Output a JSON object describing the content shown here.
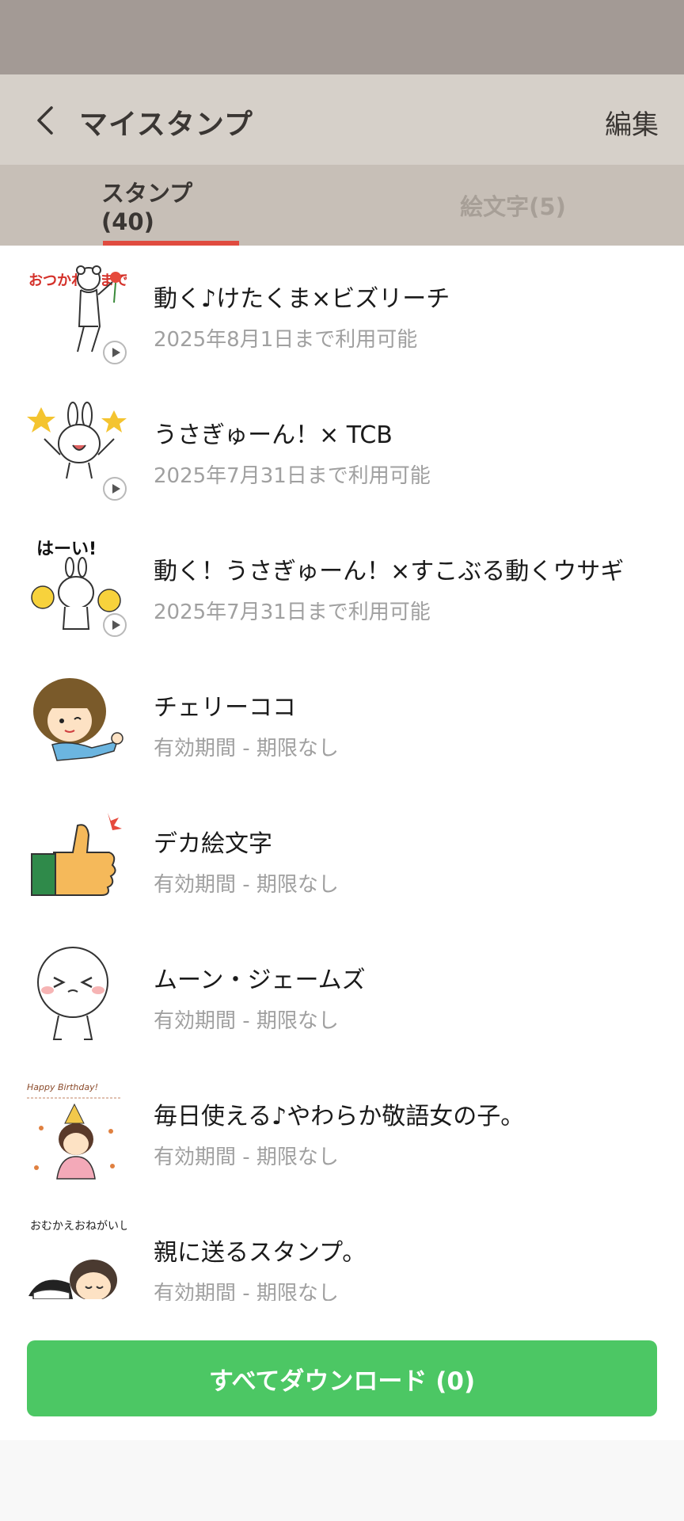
{
  "header": {
    "title": "マイスタンプ",
    "edit_label": "編集"
  },
  "tabs": [
    {
      "label": "スタンプ(40)",
      "active": true
    },
    {
      "label": "絵文字(5)",
      "active": false
    }
  ],
  "items": [
    {
      "name": "動く♪けたくま×ビズリーチ",
      "sub": "2025年8月1日まで利用可能",
      "animated": true,
      "thumb_text": "おつかれさまです"
    },
    {
      "name": "うさぎゅーん！× TCB",
      "sub": "2025年7月31日まで利用可能",
      "animated": true
    },
    {
      "name": "動く！うさぎゅーん！×すこぶる動くウサギ",
      "sub": "2025年7月31日まで利用可能",
      "animated": true,
      "thumb_text": "はーい!"
    },
    {
      "name": "チェリーココ",
      "sub": "有効期間 - 期限なし",
      "animated": false
    },
    {
      "name": "デカ絵文字",
      "sub": "有効期間 - 期限なし",
      "animated": false
    },
    {
      "name": "ムーン・ジェームズ",
      "sub": "有効期間 - 期限なし",
      "animated": false
    },
    {
      "name": "毎日使える♪やわらか敬語女の子。",
      "sub": "有効期間 - 期限なし",
      "animated": false,
      "thumb_text": "Happy Birthday!"
    },
    {
      "name": "親に送るスタンプ。",
      "sub": "有効期間 - 期限なし",
      "animated": false,
      "thumb_text": "おむかえおねがいします"
    }
  ],
  "footer": {
    "download_label": "すべてダウンロード (0)"
  },
  "colors": {
    "accent_green": "#4cc764",
    "tab_indicator": "#e04b3f",
    "header_bg": "#d6d0c9"
  },
  "icons": {
    "back": "chevron-left-icon",
    "play": "play-icon"
  }
}
